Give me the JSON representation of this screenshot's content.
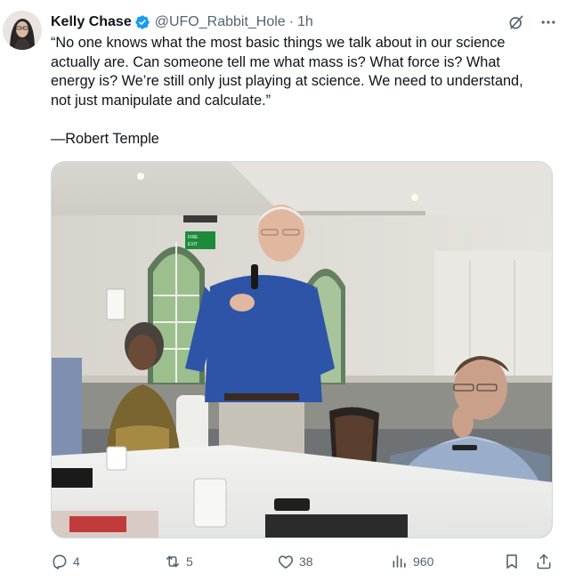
{
  "author": {
    "name": "Kelly Chase",
    "handle": "@UFO_Rabbit_Hole",
    "separator": "·",
    "time": "1h"
  },
  "post": {
    "lines": [
      "“No one knows what the most basic things we talk about in our science",
      "actually are. Can someone tell me what mass is? What force is? What",
      "energy is? We’re still only just playing at science. We need to understand,",
      "not just manipulate and calculate.”"
    ],
    "attribution": "—Robert Temple"
  },
  "media": {
    "sign_text_1": "FIRE",
    "sign_text_2": "EXIT"
  },
  "actions": {
    "replies": "4",
    "reposts": "5",
    "likes": "38",
    "views": "960"
  },
  "colors": {
    "text": "#0f1419",
    "secondary": "#536471",
    "verified": "#1d9bf0",
    "border": "#cfd9de"
  },
  "icons": [
    "verified-badge-icon",
    "grok-icon",
    "more-icon",
    "reply-icon",
    "repost-icon",
    "like-icon",
    "views-icon",
    "bookmark-icon",
    "share-icon"
  ]
}
